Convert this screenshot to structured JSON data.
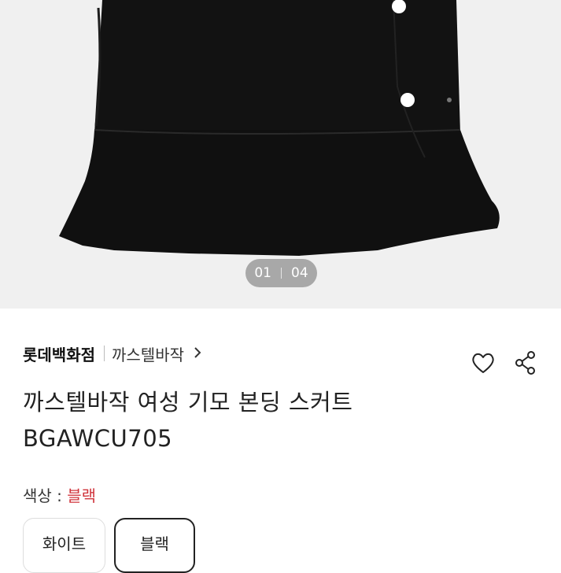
{
  "gallery": {
    "current": "01",
    "total": "04"
  },
  "brand_row": {
    "store": "롯데백화점",
    "brand": "까스텔바작",
    "chevron": "›"
  },
  "actions": {
    "wishlist_icon": "heart-icon",
    "share_icon": "share-icon"
  },
  "product": {
    "title_line1": "까스텔바작 여성 기모 본딩 스커트",
    "title_line2": "BGAWCU705"
  },
  "color": {
    "label": "색상 : ",
    "selected": "블랙",
    "options": [
      {
        "label": "화이트",
        "selected": false
      },
      {
        "label": "블랙",
        "selected": true
      }
    ]
  },
  "colors": {
    "accent_red": "#d0343c",
    "hero_bg": "#f0f0f0",
    "skirt": "#111111"
  }
}
